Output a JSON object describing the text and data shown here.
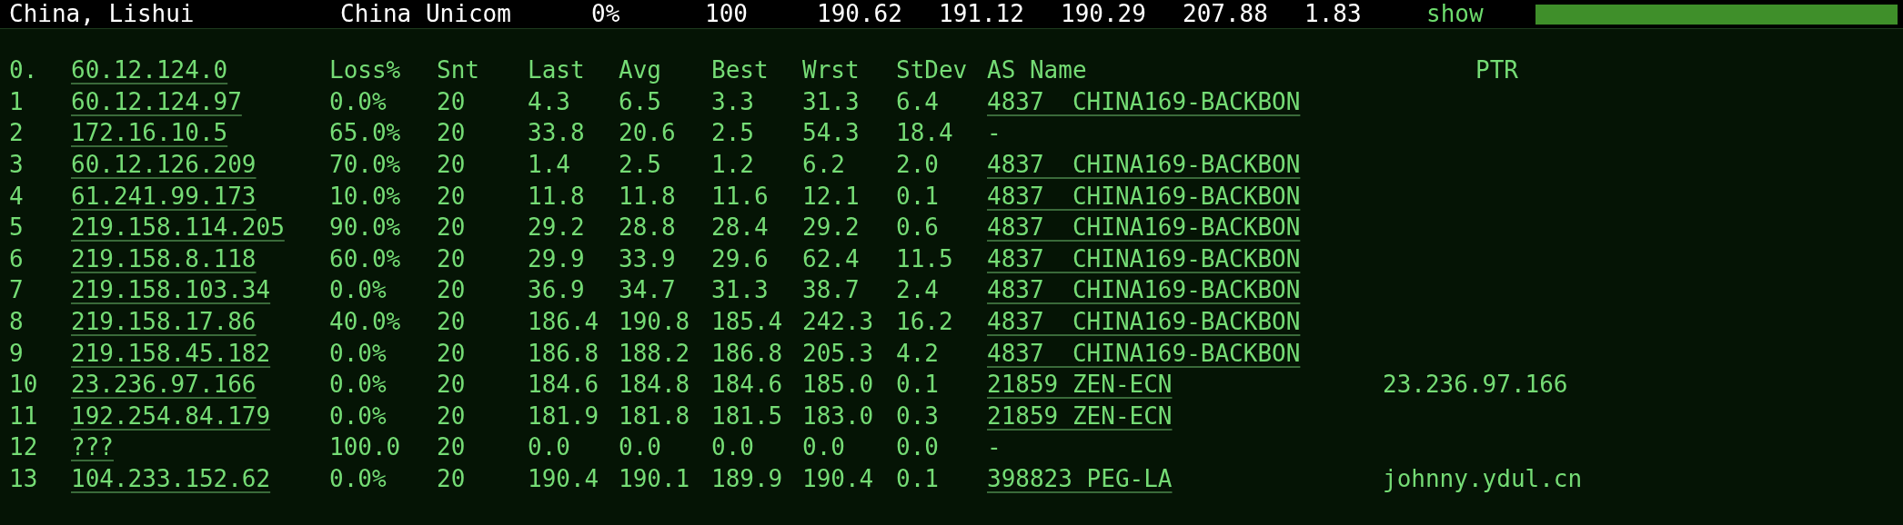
{
  "top_bar": {
    "location": "China, Lishui",
    "isp": "China Unicom",
    "loss": "0%",
    "sent": "100",
    "stats": [
      "190.62",
      "191.12",
      "190.29",
      "207.88",
      "1.83"
    ],
    "show_link": "show",
    "bar": {
      "level": 1
    }
  },
  "header": {
    "index": "0.",
    "host": "60.12.124.0",
    "columns": [
      "Loss%",
      "Snt",
      "Last",
      "Avg",
      "Best",
      "Wrst",
      "StDev",
      "AS Name",
      "PTR"
    ]
  },
  "hops": [
    {
      "index": "1",
      "host": "60.12.124.97",
      "loss": "0.0%",
      "snt": "20",
      "last": "4.3",
      "avg": "6.5",
      "best": "3.3",
      "wrst": "31.3",
      "stdev": "6.4",
      "as": "4837  CHINA169-BACKBON",
      "as_linked": true
    },
    {
      "index": "2",
      "host": "172.16.10.5",
      "loss": "65.0%",
      "snt": "20",
      "last": "33.8",
      "avg": "20.6",
      "best": "2.5",
      "wrst": "54.3",
      "stdev": "18.4",
      "as": "-",
      "as_linked": false
    },
    {
      "index": "3",
      "host": "60.12.126.209",
      "loss": "70.0%",
      "snt": "20",
      "last": "1.4",
      "avg": "2.5",
      "best": "1.2",
      "wrst": "6.2",
      "stdev": "2.0",
      "as": "4837  CHINA169-BACKBON",
      "as_linked": true
    },
    {
      "index": "4",
      "host": "61.241.99.173",
      "loss": "10.0%",
      "snt": "20",
      "last": "11.8",
      "avg": "11.8",
      "best": "11.6",
      "wrst": "12.1",
      "stdev": "0.1",
      "as": "4837  CHINA169-BACKBON",
      "as_linked": true
    },
    {
      "index": "5",
      "host": "219.158.114.205",
      "loss": "90.0%",
      "snt": "20",
      "last": "29.2",
      "avg": "28.8",
      "best": "28.4",
      "wrst": "29.2",
      "stdev": "0.6",
      "as": "4837  CHINA169-BACKBON",
      "as_linked": true
    },
    {
      "index": "6",
      "host": "219.158.8.118",
      "loss": "60.0%",
      "snt": "20",
      "last": "29.9",
      "avg": "33.9",
      "best": "29.6",
      "wrst": "62.4",
      "stdev": "11.5",
      "as": "4837  CHINA169-BACKBON",
      "as_linked": true
    },
    {
      "index": "7",
      "host": "219.158.103.34",
      "loss": "0.0%",
      "snt": "20",
      "last": "36.9",
      "avg": "34.7",
      "best": "31.3",
      "wrst": "38.7",
      "stdev": "2.4",
      "as": "4837  CHINA169-BACKBON",
      "as_linked": true
    },
    {
      "index": "8",
      "host": "219.158.17.86",
      "loss": "40.0%",
      "snt": "20",
      "last": "186.4",
      "avg": "190.8",
      "best": "185.4",
      "wrst": "242.3",
      "stdev": "16.2",
      "as": "4837  CHINA169-BACKBON",
      "as_linked": true
    },
    {
      "index": "9",
      "host": "219.158.45.182",
      "loss": "0.0%",
      "snt": "20",
      "last": "186.8",
      "avg": "188.2",
      "best": "186.8",
      "wrst": "205.3",
      "stdev": "4.2",
      "as": "4837  CHINA169-BACKBON",
      "as_linked": true
    },
    {
      "index": "10",
      "host": "23.236.97.166",
      "loss": "0.0%",
      "snt": "20",
      "last": "184.6",
      "avg": "184.8",
      "best": "184.6",
      "wrst": "185.0",
      "stdev": "0.1",
      "as": "21859 ZEN-ECN",
      "as_linked": true,
      "ptr": "23.236.97.166"
    },
    {
      "index": "11",
      "host": "192.254.84.179",
      "loss": "0.0%",
      "snt": "20",
      "last": "181.9",
      "avg": "181.8",
      "best": "181.5",
      "wrst": "183.0",
      "stdev": "0.3",
      "as": "21859 ZEN-ECN",
      "as_linked": true
    },
    {
      "index": "12",
      "host": "???",
      "loss": "100.0",
      "snt": "20",
      "last": "0.0",
      "avg": "0.0",
      "best": "0.0",
      "wrst": "0.0",
      "stdev": "0.0",
      "as": "-",
      "as_linked": false
    },
    {
      "index": "13",
      "host": "104.233.152.62",
      "loss": "0.0%",
      "snt": "20",
      "last": "190.4",
      "avg": "190.1",
      "best": "189.9",
      "wrst": "190.4",
      "stdev": "0.1",
      "as": "398823 PEG-LA",
      "as_linked": true,
      "ptr": "johnny.ydul.cn"
    }
  ]
}
